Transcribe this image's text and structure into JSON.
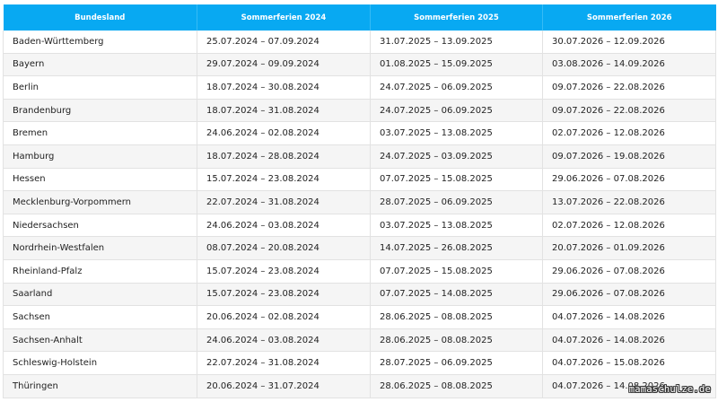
{
  "table": {
    "headers": [
      "Bundesland",
      "Sommerferien 2024",
      "Sommerferien 2025",
      "Sommerferien 2026"
    ],
    "rows": [
      [
        "Baden-Württemberg",
        "25.07.2024 – 07.09.2024",
        "31.07.2025 – 13.09.2025",
        "30.07.2026 – 12.09.2026"
      ],
      [
        "Bayern",
        "29.07.2024 – 09.09.2024",
        "01.08.2025 – 15.09.2025",
        "03.08.2026 – 14.09.2026"
      ],
      [
        "Berlin",
        "18.07.2024 – 30.08.2024",
        "24.07.2025 – 06.09.2025",
        "09.07.2026 – 22.08.2026"
      ],
      [
        "Brandenburg",
        "18.07.2024 – 31.08.2024",
        "24.07.2025 – 06.09.2025",
        "09.07.2026 – 22.08.2026"
      ],
      [
        "Bremen",
        "24.06.2024 – 02.08.2024",
        "03.07.2025 – 13.08.2025",
        "02.07.2026 – 12.08.2026"
      ],
      [
        "Hamburg",
        "18.07.2024 – 28.08.2024",
        "24.07.2025 – 03.09.2025",
        "09.07.2026 – 19.08.2026"
      ],
      [
        "Hessen",
        "15.07.2024 – 23.08.2024",
        "07.07.2025 – 15.08.2025",
        "29.06.2026 – 07.08.2026"
      ],
      [
        "Mecklenburg-Vorpommern",
        "22.07.2024 – 31.08.2024",
        "28.07.2025 – 06.09.2025",
        "13.07.2026 – 22.08.2026"
      ],
      [
        "Niedersachsen",
        "24.06.2024 – 03.08.2024",
        "03.07.2025 – 13.08.2025",
        "02.07.2026 – 12.08.2026"
      ],
      [
        "Nordrhein-Westfalen",
        "08.07.2024 – 20.08.2024",
        "14.07.2025 – 26.08.2025",
        "20.07.2026 – 01.09.2026"
      ],
      [
        "Rheinland-Pfalz",
        "15.07.2024 – 23.08.2024",
        "07.07.2025 – 15.08.2025",
        "29.06.2026 – 07.08.2026"
      ],
      [
        "Saarland",
        "15.07.2024 – 23.08.2024",
        "07.07.2025 – 14.08.2025",
        "29.06.2026 – 07.08.2026"
      ],
      [
        "Sachsen",
        "20.06.2024 – 02.08.2024",
        "28.06.2025 – 08.08.2025",
        "04.07.2026 – 14.08.2026"
      ],
      [
        "Sachsen-Anhalt",
        "24.06.2024 – 03.08.2024",
        "28.06.2025 – 08.08.2025",
        "04.07.2026 – 14.08.2026"
      ],
      [
        "Schleswig-Holstein",
        "22.07.2024 – 31.08.2024",
        "28.07.2025 – 06.09.2025",
        "04.07.2026 – 15.08.2026"
      ],
      [
        "Thüringen",
        "20.06.2024 – 31.07.2024",
        "28.06.2025 – 08.08.2025",
        "04.07.2026 – 14.08.2026"
      ]
    ]
  },
  "watermark": "mamaschulze.de",
  "colors": {
    "header_bg": "#08a9f2",
    "header_text": "#ffffff",
    "row_alt_bg": "#f5f5f5",
    "border": "#e2e2e2"
  }
}
